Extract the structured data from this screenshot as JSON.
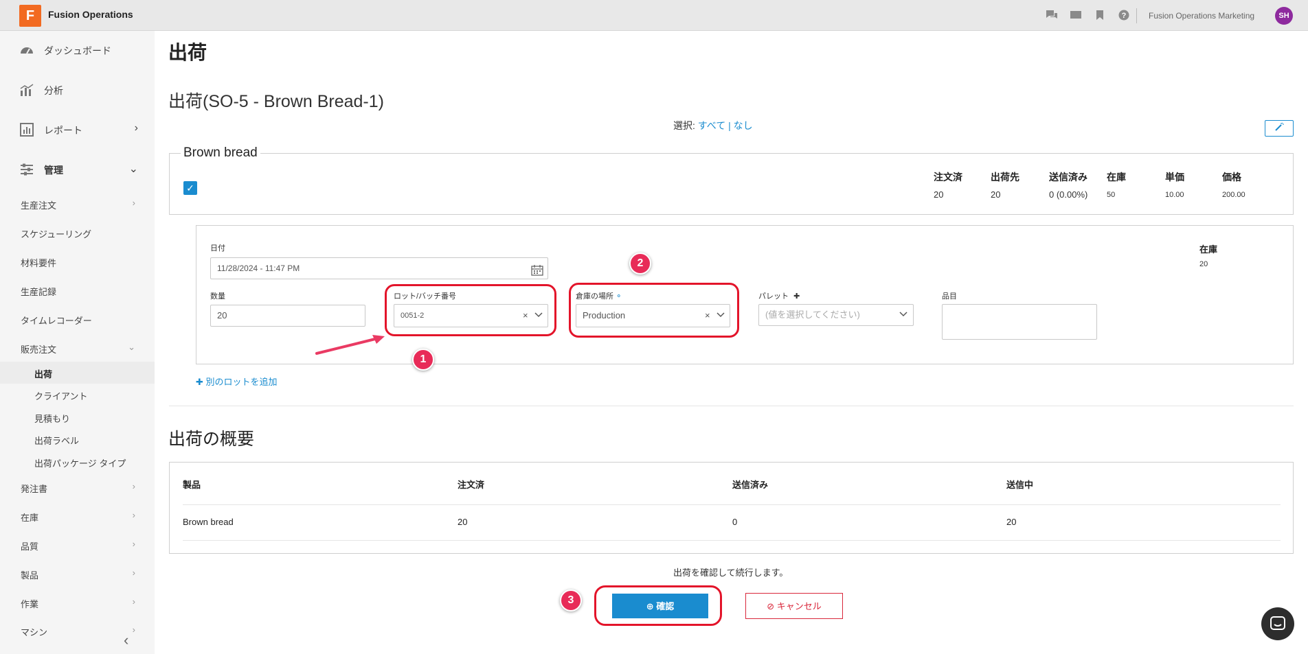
{
  "topbar": {
    "logo_letter": "F",
    "app_name": "Fusion Operations",
    "icons": [
      "chat-icon",
      "monitor-icon",
      "bookmark-icon",
      "help-icon"
    ],
    "org_name": "Fusion Operations Marketing",
    "avatar_initials": "SH",
    "avatar_color": "#8e2a9e"
  },
  "sidebar": {
    "main_items": [
      {
        "label": "ダッシュボード",
        "icon": "gauge-icon"
      },
      {
        "label": "分析",
        "icon": "chart-icon"
      },
      {
        "label": "レポート",
        "icon": "report-icon"
      },
      {
        "label": "管理",
        "icon": "sliders-icon"
      }
    ],
    "manage_items": [
      "生産注文",
      "スケジューリング",
      "材料要件",
      "生産記録",
      "タイムレコーダー",
      "販売注文"
    ],
    "sales_items": [
      "出荷",
      "クライアント",
      "見積もり",
      "出荷ラベル",
      "出荷パッケージ タイプ"
    ],
    "more_items": [
      "発注書",
      "在庫",
      "品質",
      "製品",
      "作業",
      "マシン"
    ]
  },
  "page": {
    "title": "出荷",
    "subtitle": "出荷(SO-5 - Brown Bread-1)",
    "select_label": "選択:",
    "select_all": "すべて",
    "select_sep": "|",
    "select_none": "なし"
  },
  "product": {
    "name": "Brown bread",
    "checked": true,
    "columns": [
      {
        "header": "注文済",
        "value": "20"
      },
      {
        "header": "出荷先",
        "value": "20"
      },
      {
        "header": "送信済み",
        "value": "0 (0.00%)"
      },
      {
        "header": "在庫",
        "value": "50"
      },
      {
        "header": "単価",
        "value": "10.00"
      },
      {
        "header": "価格",
        "value": "200.00"
      }
    ]
  },
  "lot_form": {
    "date_label": "日付",
    "date_value": "11/28/2024 - 11:47 PM",
    "qty_label": "数量",
    "qty_value": "20",
    "lot_label": "ロット/バッチ番号",
    "lot_value": "0051-2",
    "location_label": "倉庫の場所",
    "location_value": "Production",
    "pallet_label": "パレット",
    "pallet_placeholder": "(値を選択してください)",
    "item_label": "品目",
    "stock_label": "在庫",
    "stock_value": "20"
  },
  "add_lot": "別のロットを追加",
  "summary": {
    "title": "出荷の概要",
    "headers": [
      "製品",
      "注文済",
      "送信済み",
      "送信中"
    ],
    "rows": [
      [
        "Brown bread",
        "20",
        "0",
        "20"
      ]
    ]
  },
  "footer": {
    "note": "出荷を確認して続行します。",
    "confirm": "確認",
    "cancel": "キャンセル"
  },
  "annotations": {
    "badges": [
      "1",
      "2",
      "3"
    ],
    "color": "#e3142a"
  }
}
